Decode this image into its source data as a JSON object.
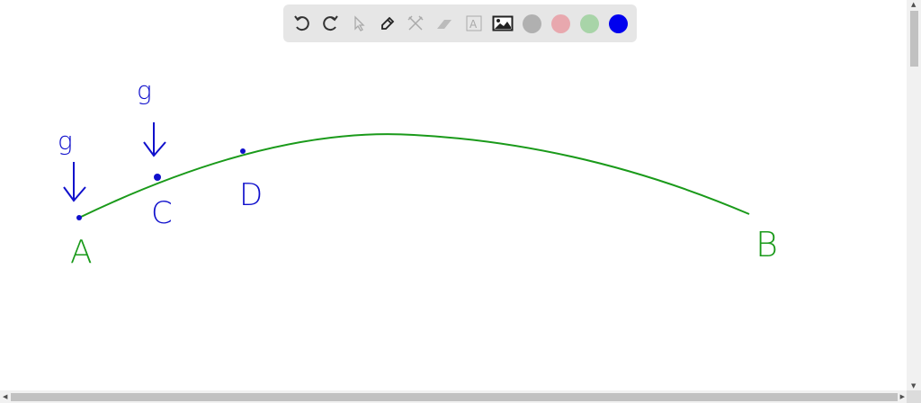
{
  "toolbar": {
    "tools": [
      "undo-icon",
      "redo-icon",
      "select-icon",
      "pen-icon",
      "tools-icon",
      "eraser-icon",
      "text-icon",
      "image-icon"
    ],
    "colors": [
      "#b0b0b0",
      "#e8a8ae",
      "#a8d4a8",
      "#0000ee"
    ],
    "selected_color": "#0000ee"
  },
  "drawing": {
    "curve_color": "#1a9a1a",
    "ink_color": "#1010cc",
    "labels": {
      "A": "A",
      "B": "B",
      "C": "C",
      "D": "D",
      "g1": "g",
      "g2": "g"
    }
  }
}
